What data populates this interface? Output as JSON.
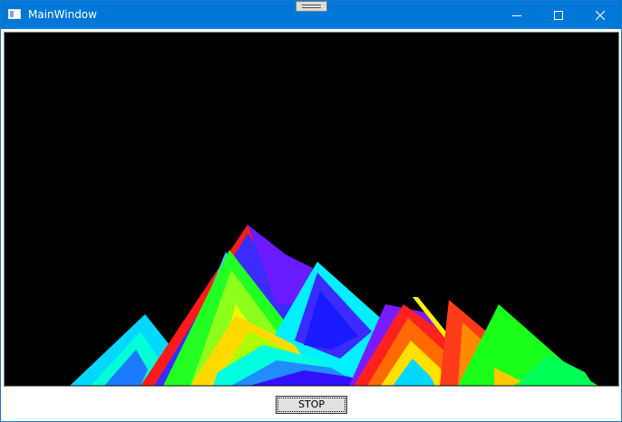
{
  "window": {
    "title": "MainWindow",
    "titlebar_color": "#0078d7",
    "controls": [
      "minimize-icon",
      "maximize-icon",
      "close-icon"
    ]
  },
  "canvas": {
    "background": "#000000",
    "content": "rainbow-mountain-pattern"
  },
  "toolbar": {
    "stop_label": "STOP"
  }
}
